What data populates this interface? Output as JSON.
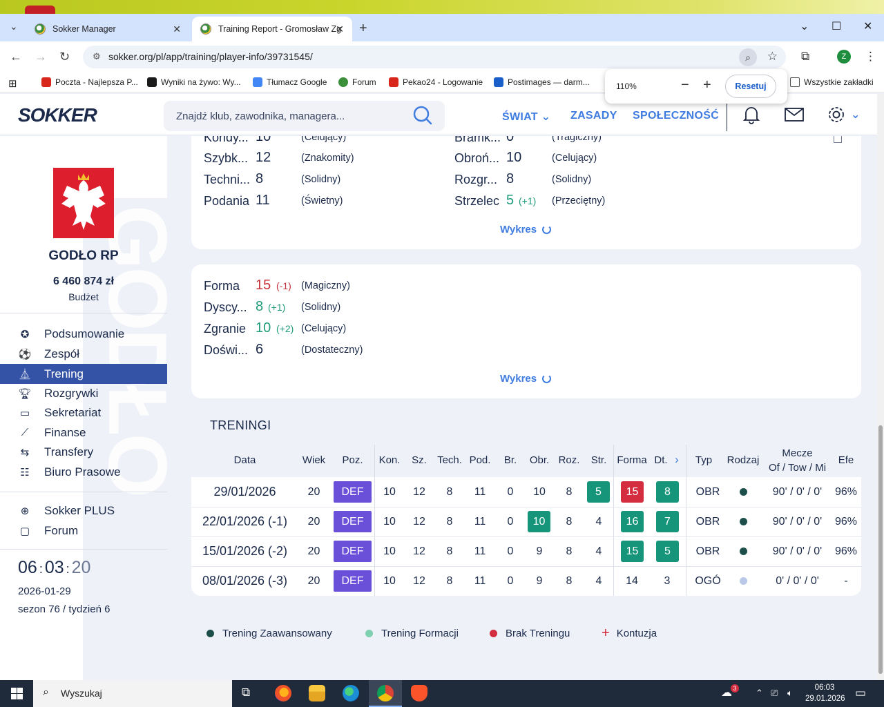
{
  "browser": {
    "tabs": [
      {
        "label": "Sokker Manager"
      },
      {
        "label": "Training Report - Gromosław Zg"
      }
    ],
    "url": "sokker.org/pl/app/training/player-info/39731545/",
    "bookmarks": [
      {
        "label": "Poczta - Najlepsza P...",
        "color": "#d9261c"
      },
      {
        "label": "Wyniki na żywo: Wy...",
        "color": "#1a1a1a"
      },
      {
        "label": "Tłumacz Google",
        "color": "#4285f4"
      },
      {
        "label": "Forum",
        "color": "#3b8f3b"
      },
      {
        "label": "Pekao24 - Logowanie",
        "color": "#d9261c"
      },
      {
        "label": "Postimages — darm...",
        "color": "#1a5fc9"
      },
      {
        "label": "Wszystkie zakładki",
        "color": "#555555"
      }
    ],
    "zoom": {
      "level": "110%",
      "reset_label": "Resetuj"
    }
  },
  "header": {
    "logo": "SOKKER",
    "search_placeholder": "Znajdź klub, zawodnika, managera...",
    "nav": [
      "ŚWIAT",
      "ZASADY",
      "SPOŁECZNOŚĆ"
    ]
  },
  "sidebar": {
    "club_name": "GODŁO RP",
    "budget_value": "6 460 874 zł",
    "budget_label": "Budżet",
    "menu": [
      {
        "label": "Podsumowanie",
        "icon": "medal-icon"
      },
      {
        "label": "Zespół",
        "icon": "ball-icon"
      },
      {
        "label": "Trening",
        "icon": "cone-icon",
        "active": true
      },
      {
        "label": "Rozgrywki",
        "icon": "trophy-icon"
      },
      {
        "label": "Sekretariat",
        "icon": "briefcase-icon"
      },
      {
        "label": "Finanse",
        "icon": "chart-icon"
      },
      {
        "label": "Transfery",
        "icon": "swap-icon"
      },
      {
        "label": "Biuro Prasowe",
        "icon": "newspaper-icon"
      }
    ],
    "extra": [
      {
        "label": "Sokker PLUS",
        "icon": "plus-circle-icon"
      },
      {
        "label": "Forum",
        "icon": "chat-icon"
      }
    ],
    "clock": {
      "h": "06",
      "m": "03",
      "s": "20"
    },
    "date": "2026-01-29",
    "season": "sezon 76 / tydzień 6"
  },
  "skills": {
    "left": [
      {
        "name": "Kondy...",
        "value": "10",
        "delta": "",
        "desc": "(Celujący)"
      },
      {
        "name": "Szybk...",
        "value": "12",
        "delta": "",
        "desc": "(Znakomity)"
      },
      {
        "name": "Techni...",
        "value": "8",
        "delta": "",
        "desc": "(Solidny)"
      },
      {
        "name": "Podania",
        "value": "11",
        "delta": "",
        "desc": "(Świetny)"
      }
    ],
    "right": [
      {
        "name": "Bramk...",
        "value": "0",
        "delta": "",
        "desc": "(Tragiczny)"
      },
      {
        "name": "Obroń...",
        "value": "10",
        "delta": "",
        "desc": "(Celujący)"
      },
      {
        "name": "Rozgr...",
        "value": "8",
        "delta": "",
        "desc": "(Solidny)"
      },
      {
        "name": "Strzelec",
        "value": "5",
        "delta": "(+1)",
        "desc": "(Przeciętny)"
      }
    ],
    "chart_label": "Wykres"
  },
  "condition": {
    "rows": [
      {
        "name": "Forma",
        "value": "15",
        "delta": "(-1)",
        "desc": "(Magiczny)",
        "tone": "red"
      },
      {
        "name": "Dyscy...",
        "value": "8",
        "delta": "(+1)",
        "desc": "(Solidny)",
        "tone": "green"
      },
      {
        "name": "Zgranie",
        "value": "10",
        "delta": "(+2)",
        "desc": "(Celujący)",
        "tone": "green"
      },
      {
        "name": "Doświ...",
        "value": "6",
        "delta": "",
        "desc": "(Dostateczny)",
        "tone": ""
      }
    ],
    "chart_label": "Wykres"
  },
  "trainings": {
    "title": "TRENINGI",
    "headers": [
      "Data",
      "Wiek",
      "Poz.",
      "Kon.",
      "Sz.",
      "Tech.",
      "Pod.",
      "Br.",
      "Obr.",
      "Roz.",
      "Str.",
      "Forma",
      "Dt.",
      "Typ",
      "Rodzaj",
      "Mecze",
      "Of / Tow / Mi",
      "Efe"
    ],
    "rows": [
      {
        "date": "29/01/2026",
        "age": "20",
        "pos": "DEF",
        "kon": "10",
        "sz": "12",
        "tech": "8",
        "pod": "11",
        "br": "0",
        "obr": "10",
        "roz": "8",
        "str": "5",
        "forma": "15",
        "dt": "8",
        "typ": "OBR",
        "rodzaj": "#1d4f4a",
        "mecze": "90' / 0' / 0'",
        "efe": "96%"
      },
      {
        "date": "22/01/2026 (-1)",
        "age": "20",
        "pos": "DEF",
        "kon": "10",
        "sz": "12",
        "tech": "8",
        "pod": "11",
        "br": "0",
        "obr": "10",
        "roz": "8",
        "str": "4",
        "forma": "16",
        "dt": "7",
        "typ": "OBR",
        "rodzaj": "#1d4f4a",
        "mecze": "90' / 0' / 0'",
        "efe": "96%"
      },
      {
        "date": "15/01/2026 (-2)",
        "age": "20",
        "pos": "DEF",
        "kon": "10",
        "sz": "12",
        "tech": "8",
        "pod": "11",
        "br": "0",
        "obr": "9",
        "roz": "8",
        "str": "4",
        "forma": "15",
        "dt": "5",
        "typ": "OBR",
        "rodzaj": "#1d4f4a",
        "mecze": "90' / 0' / 0'",
        "efe": "96%"
      },
      {
        "date": "08/01/2026 (-3)",
        "age": "20",
        "pos": "DEF",
        "kon": "10",
        "sz": "12",
        "tech": "8",
        "pod": "11",
        "br": "0",
        "obr": "9",
        "roz": "8",
        "str": "4",
        "forma": "14",
        "dt": "3",
        "typ": "OGÓ",
        "rodzaj": "#b8c8e6",
        "mecze": "0' / 0' / 0'",
        "efe": "-"
      }
    ],
    "legend": [
      {
        "label": "Trening Zaawansowany",
        "color": "#1d4f4a"
      },
      {
        "label": "Trening Formacji",
        "color": "#7fd0b0"
      },
      {
        "label": "Brak Treningu",
        "color": "#d42d3f"
      },
      {
        "label": "Kontuzja",
        "color": "#d42d3f"
      }
    ]
  },
  "taskbar": {
    "search_placeholder": "Wyszukaj",
    "time": "06:03",
    "date": "29.01.2026",
    "weather_badge": "3"
  }
}
